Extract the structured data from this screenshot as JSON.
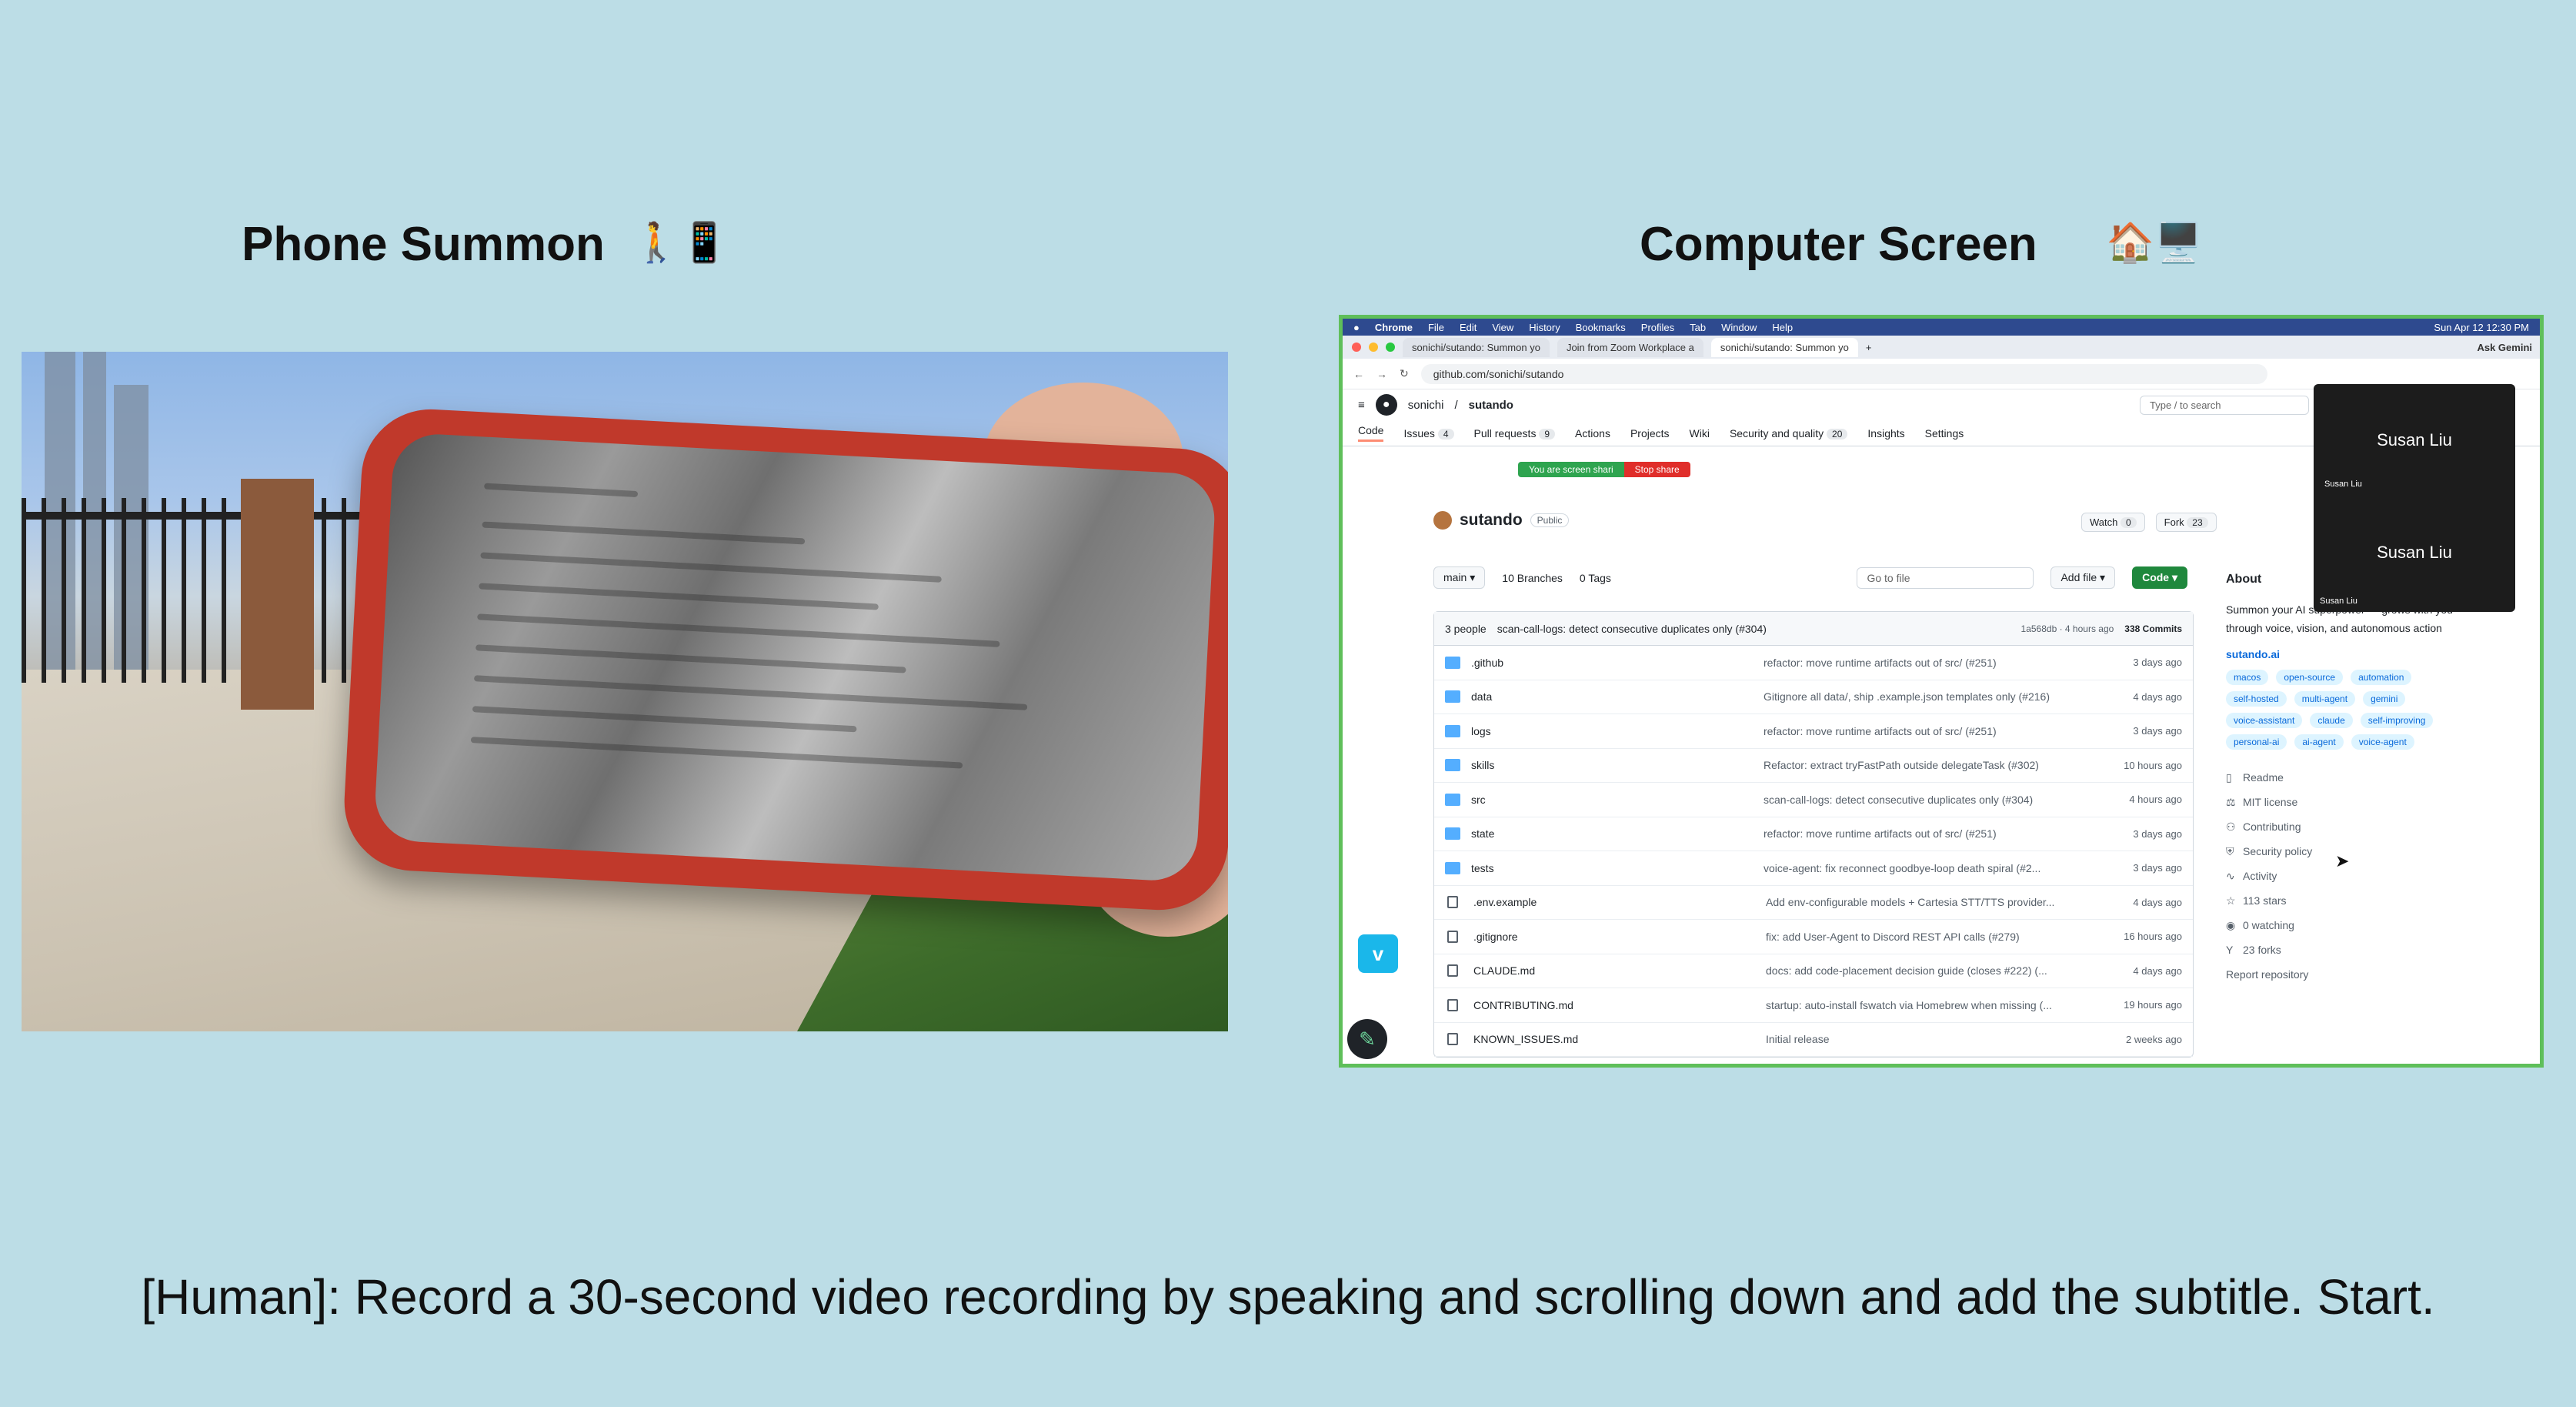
{
  "headings": {
    "left": "Phone Summon",
    "left_emoji": "🚶📱",
    "right": "Computer Screen",
    "right_emoji": "🏠🖥️"
  },
  "subtitle": "[Human]: Record a 30-second video recording by speaking and scrolling down and add the subtitle. Start.",
  "browser": {
    "menubar": [
      "Chrome",
      "File",
      "Edit",
      "View",
      "History",
      "Bookmarks",
      "Profiles",
      "Tab",
      "Window",
      "Help"
    ],
    "clock": "Sun Apr 12 12:30 PM",
    "tabs": [
      "sonichi/sutando: Summon yo",
      "Join from Zoom Workplace a",
      "sonichi/sutando: Summon yo"
    ],
    "ask_gemini": "Ask Gemini",
    "url": "github.com/sonichi/sutando"
  },
  "github": {
    "owner": "sonichi",
    "repo": "sutando",
    "search_placeholder": "Type / to search",
    "screen_share_text": "You are screen shari",
    "stop_share": "Stop share",
    "nav": [
      {
        "label": "Code",
        "count": ""
      },
      {
        "label": "Issues",
        "count": "4"
      },
      {
        "label": "Pull requests",
        "count": "9"
      },
      {
        "label": "Actions",
        "count": ""
      },
      {
        "label": "Projects",
        "count": ""
      },
      {
        "label": "Wiki",
        "count": ""
      },
      {
        "label": "Security and quality",
        "count": "20"
      },
      {
        "label": "Insights",
        "count": ""
      },
      {
        "label": "Settings",
        "count": ""
      }
    ],
    "visibility": "Public",
    "watch": "Watch",
    "watch_count": "0",
    "fork": "Fork",
    "fork_count": "23",
    "branch": "main",
    "branches": "10 Branches",
    "tags": "0 Tags",
    "go_to_file": "Go to file",
    "add_file": "Add file",
    "code_button": "Code",
    "last_commit": {
      "authors": "3 people",
      "message": "scan-call-logs: detect consecutive duplicates only (#304)",
      "hash": "1a568db · 4 hours ago",
      "commits": "338 Commits"
    },
    "files": [
      {
        "type": "dir",
        "name": ".github",
        "msg": "refactor: move runtime artifacts out of src/ (#251)",
        "ago": "3 days ago"
      },
      {
        "type": "dir",
        "name": "data",
        "msg": "Gitignore all data/, ship .example.json templates only (#216)",
        "ago": "4 days ago"
      },
      {
        "type": "dir",
        "name": "logs",
        "msg": "refactor: move runtime artifacts out of src/ (#251)",
        "ago": "3 days ago"
      },
      {
        "type": "dir",
        "name": "skills",
        "msg": "Refactor: extract tryFastPath outside delegateTask (#302)",
        "ago": "10 hours ago"
      },
      {
        "type": "dir",
        "name": "src",
        "msg": "scan-call-logs: detect consecutive duplicates only (#304)",
        "ago": "4 hours ago"
      },
      {
        "type": "dir",
        "name": "state",
        "msg": "refactor: move runtime artifacts out of src/ (#251)",
        "ago": "3 days ago"
      },
      {
        "type": "dir",
        "name": "tests",
        "msg": "voice-agent: fix reconnect goodbye-loop death spiral (#2...",
        "ago": "3 days ago"
      },
      {
        "type": "file",
        "name": ".env.example",
        "msg": "Add env-configurable models + Cartesia STT/TTS provider...",
        "ago": "4 days ago"
      },
      {
        "type": "file",
        "name": ".gitignore",
        "msg": "fix: add User-Agent to Discord REST API calls (#279)",
        "ago": "16 hours ago"
      },
      {
        "type": "file",
        "name": "CLAUDE.md",
        "msg": "docs: add code-placement decision guide (closes #222) (...",
        "ago": "4 days ago"
      },
      {
        "type": "file",
        "name": "CONTRIBUTING.md",
        "msg": "startup: auto-install fswatch via Homebrew when missing (...",
        "ago": "19 hours ago"
      },
      {
        "type": "file",
        "name": "KNOWN_ISSUES.md",
        "msg": "Initial release",
        "ago": "2 weeks ago"
      }
    ],
    "about": {
      "title": "About",
      "description": "Summon your AI superpower — grows with you through voice, vision, and autonomous action",
      "website": "sutando.ai",
      "topics": [
        "macos",
        "open-source",
        "automation",
        "self-hosted",
        "multi-agent",
        "gemini",
        "voice-assistant",
        "claude",
        "self-improving",
        "personal-ai",
        "ai-agent",
        "voice-agent"
      ],
      "links": [
        "Readme",
        "MIT license",
        "Contributing",
        "Security policy",
        "Activity",
        "113 stars",
        "0 watching",
        "23 forks"
      ],
      "report": "Report repository"
    },
    "zoom": {
      "name_top": "Susan Liu",
      "label_top": "Susan Liu",
      "name_bottom": "Susan Liu",
      "label_bottom": "Susan Liu"
    }
  }
}
